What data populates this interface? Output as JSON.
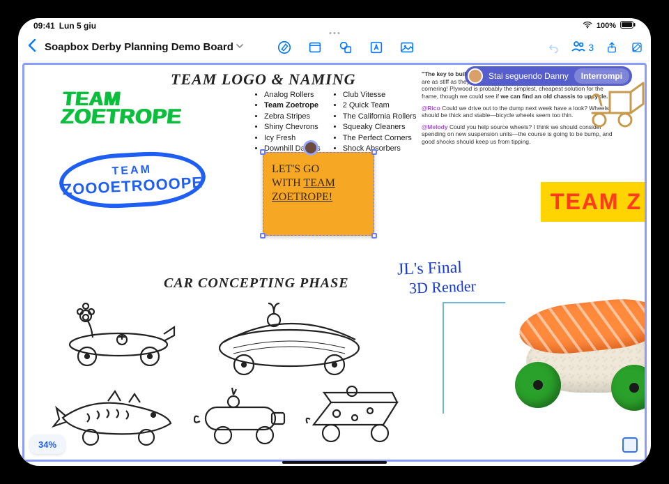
{
  "status": {
    "time": "09:41",
    "date": "Lun 5 giu",
    "battery": "100%"
  },
  "toolbar": {
    "board_title": "Soapbox Derby Planning Demo Board",
    "collab_count": "3"
  },
  "follow": {
    "label": "Stai seguendo Danny",
    "stop": "Interrompi"
  },
  "sections": {
    "logo_heading": "TEAM LOGO & NAMING",
    "car_heading": "CAR CONCEPTING PHASE"
  },
  "logo_green": {
    "line1": "TEAM",
    "line2": "ZOETROPE"
  },
  "tire": {
    "line1": "TEAM",
    "line2": "ZOOOETROOOPE"
  },
  "names_col1": [
    {
      "t": "Analog Rollers"
    },
    {
      "t": "Team Zoetrope",
      "bold": true
    },
    {
      "t": "Zebra Stripes"
    },
    {
      "t": "Shiny Chevrons"
    },
    {
      "t": "Icy Fresh"
    },
    {
      "t": "Downhill Daisies"
    }
  ],
  "names_col2": [
    {
      "t": "Club Vitesse"
    },
    {
      "t": "2 Quick Team"
    },
    {
      "t": "The California Rollers"
    },
    {
      "t": "Squeaky Cleaners"
    },
    {
      "t": "The Perfect Corners"
    },
    {
      "t": "Shock Absorbers"
    }
  ],
  "sticky": {
    "line1": "LET'S GO",
    "line2": "WITH ",
    "underline": "TEAM",
    "line3": "ZOETROPE!"
  },
  "convo": {
    "p1a": "\"The key to building a",
    "p1b": "are as stiff as they are",
    "p1c": "cornering! Plywood is probably the simplest, cheapest solution for the frame, though we could see if ",
    "p1d": "we can find an old chassis to upcycle.",
    "m1": "@Rico",
    "p2": " Could we drive out to the dump next week have a look? Wheels should be thick and stable—bicycle wheels seem too thin.",
    "m2": "@Melody",
    "p3": " Could you help source wheels? I think we should consider spending on new suspension units—the course is going to be bump, and good shocks should keep us from tipping."
  },
  "teamz": "TEAM Z",
  "jl": {
    "l1": "JL's Final",
    "l2": "3D Render"
  },
  "zoom": "34%"
}
